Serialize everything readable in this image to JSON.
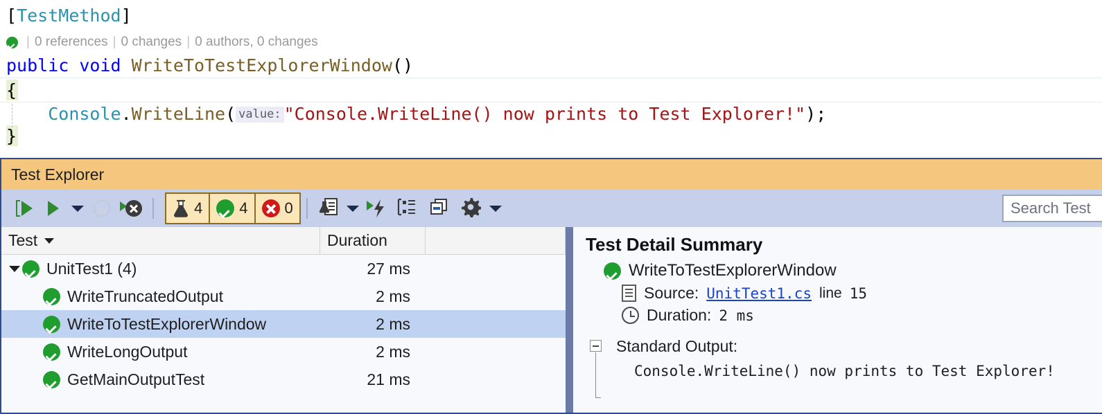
{
  "editor": {
    "attribute_line": "[TestMethod]",
    "attribute_open": "[",
    "attribute_name": "TestMethod",
    "attribute_close": "]",
    "codelens": {
      "status_icon": "check-circle-icon",
      "references": "0 references",
      "changes": "0 changes",
      "authors": "0 authors, 0 changes",
      "separator": "|"
    },
    "signature": {
      "modifier": "public",
      "return_type": "void",
      "method_name": "WriteToTestExplorerWindow",
      "parens": "()"
    },
    "open_brace": "{",
    "close_brace": "}",
    "body": {
      "class_name": "Console",
      "dot": ".",
      "method": "WriteLine",
      "open_paren": "(",
      "param_hint": "value:",
      "string_literal": "\"Console.WriteLine() now prints to Test Explorer!\"",
      "close_paren": ")",
      "semicolon": ";"
    },
    "colors": {
      "keyword": "#0000ff",
      "type": "#2b91af",
      "method": "#795e26",
      "string": "#a31515",
      "codelens_text": "#9a9a9a",
      "hint_bg": "#ececf6"
    }
  },
  "test_explorer": {
    "title": "Test Explorer",
    "title_bar_color": "#f5c77e",
    "toolbar_color": "#c7d0ea",
    "toolbar": {
      "run_all_tests": "run-all-tests",
      "run": "run",
      "run_dropdown": "run-dropdown",
      "repeat_last_run": "repeat-last-run",
      "stop": "stop",
      "status_buttons": [
        {
          "icon": "flask-icon",
          "label": "4",
          "name": "total-tests"
        },
        {
          "icon": "check-circle-icon",
          "label": "4",
          "name": "passed-tests"
        },
        {
          "icon": "error-circle-icon",
          "label": "0",
          "name": "failed-tests"
        }
      ],
      "test_playlist": "test-playlist",
      "playlist_dropdown": "playlist-dropdown",
      "run_until_failure": "run-until-failure",
      "group_by": "group-by",
      "show_test_output": "show-test-output",
      "settings": "settings",
      "settings_dropdown": "settings-dropdown"
    },
    "search": {
      "placeholder": "Search Test",
      "value": ""
    },
    "columns": [
      {
        "label": "Test",
        "sorted": true
      },
      {
        "label": "Duration",
        "sorted": false
      },
      {
        "label": "",
        "sorted": false
      }
    ],
    "rows": [
      {
        "name": "UnitTest1  (4)",
        "duration": "27 ms",
        "level": 0,
        "status": "passed",
        "expanded": true,
        "selected": false
      },
      {
        "name": "WriteTruncatedOutput",
        "duration": "2 ms",
        "level": 1,
        "status": "passed",
        "expanded": false,
        "selected": false
      },
      {
        "name": "WriteToTestExplorerWindow",
        "duration": "2 ms",
        "level": 1,
        "status": "passed",
        "expanded": false,
        "selected": true
      },
      {
        "name": "WriteLongOutput",
        "duration": "2 ms",
        "level": 1,
        "status": "passed",
        "expanded": false,
        "selected": false
      },
      {
        "name": "GetMainOutputTest",
        "duration": "21 ms",
        "level": 1,
        "status": "passed",
        "expanded": false,
        "selected": false
      }
    ],
    "detail": {
      "heading": "Test Detail Summary",
      "test_name": "WriteToTestExplorerWindow",
      "source_label": "Source:",
      "source_file": "UnitTest1.cs",
      "line_label": "line",
      "line_number": "15",
      "duration_label": "Duration:",
      "duration_value": "2 ms",
      "standard_output_label": "Standard Output:",
      "standard_output_text": "Console.WriteLine() now prints to Test Explorer!"
    },
    "colors": {
      "selection": "#bfd2f2",
      "splitter": "#6b7ba8",
      "window_border": "#2d4b8e",
      "status_button_bg": "#fbe6b9",
      "status_button_border": "#8a6d1f",
      "pass_green": "#1f9d2f",
      "fail_red": "#d01919",
      "link_blue": "#1a43c8"
    }
  }
}
